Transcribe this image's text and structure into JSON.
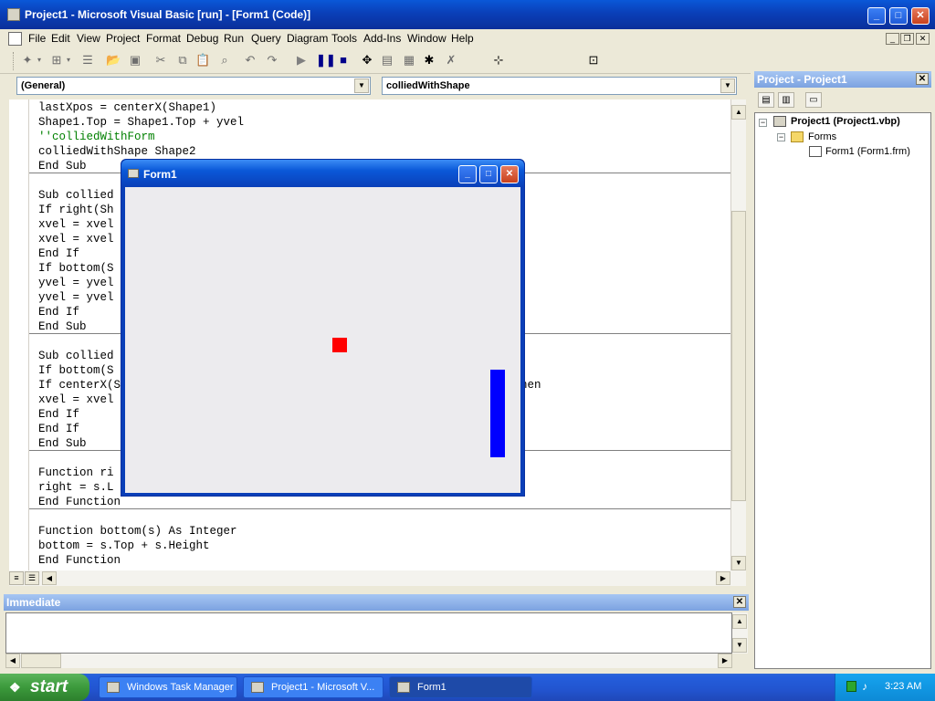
{
  "window": {
    "title": "Project1 - Microsoft Visual Basic [run] - [Form1 (Code)]",
    "min_glyph": "_",
    "max_glyph": "□",
    "close_glyph": "✕"
  },
  "menu": {
    "items": [
      "File",
      "Edit",
      "View",
      "Project",
      "Format",
      "Debug",
      "Run",
      "Query",
      "Diagram",
      "Tools",
      "Add-Ins",
      "Window",
      "Help"
    ]
  },
  "code_window": {
    "object_combo": "(General)",
    "procedure_combo": "colliedWithShape",
    "lines": [
      {
        "text": "lastXpos = centerX(Shape1)",
        "kind": "code"
      },
      {
        "text": "Shape1.Top = Shape1.Top + yvel",
        "kind": "code"
      },
      {
        "text": "''colliedWithForm",
        "kind": "comment"
      },
      {
        "text": "colliedWithShape Shape2",
        "kind": "code"
      },
      {
        "text": "End Sub",
        "kind": "code"
      },
      {
        "text": "Sub collied",
        "kind": "code"
      },
      {
        "text": "If right(Sh",
        "kind": "code"
      },
      {
        "text": "xvel = xvel",
        "kind": "code"
      },
      {
        "text": "xvel = xvel",
        "kind": "code"
      },
      {
        "text": "End If",
        "kind": "code"
      },
      {
        "text": "If bottom(S",
        "kind": "code"
      },
      {
        "text": "yvel = yvel",
        "kind": "code"
      },
      {
        "text": "yvel = yvel",
        "kind": "code"
      },
      {
        "text": "End If",
        "kind": "code"
      },
      {
        "text": "End Sub",
        "kind": "code"
      },
      {
        "text": "Sub collied",
        "kind": "code"
      },
      {
        "text": "If bottom(S",
        "kind": "code"
      },
      {
        "text": "If centerX(S",
        "kind": "code"
      },
      {
        "text": "xvel = xvel",
        "kind": "code"
      },
      {
        "text": "End If",
        "kind": "code"
      },
      {
        "text": "End If",
        "kind": "code"
      },
      {
        "text": "End Sub",
        "kind": "code"
      },
      {
        "text": "Function ri",
        "kind": "code"
      },
      {
        "text": "right = s.L",
        "kind": "code"
      },
      {
        "text": "End Function",
        "kind": "code"
      },
      {
        "text": "Function bottom(s) As Integer",
        "kind": "code"
      },
      {
        "text": "bottom = s.Top + s.Height",
        "kind": "code"
      },
      {
        "text": "End Function",
        "kind": "code"
      }
    ],
    "overflow_fragment": "hen"
  },
  "immediate": {
    "title": "Immediate"
  },
  "project_explorer": {
    "title": "Project - Project1",
    "tree": {
      "project": "Project1 (Project1.vbp)",
      "folder": "Forms",
      "form": "Form1 (Form1.frm)"
    }
  },
  "form1": {
    "title": "Form1",
    "ball_color": "#ff0000",
    "paddle_color": "#0000ff"
  },
  "taskbar": {
    "start_label": "start",
    "tasks": [
      "Windows Task Manager",
      "Project1 - Microsoft V...",
      "Form1"
    ],
    "clock": "3:23 AM"
  }
}
